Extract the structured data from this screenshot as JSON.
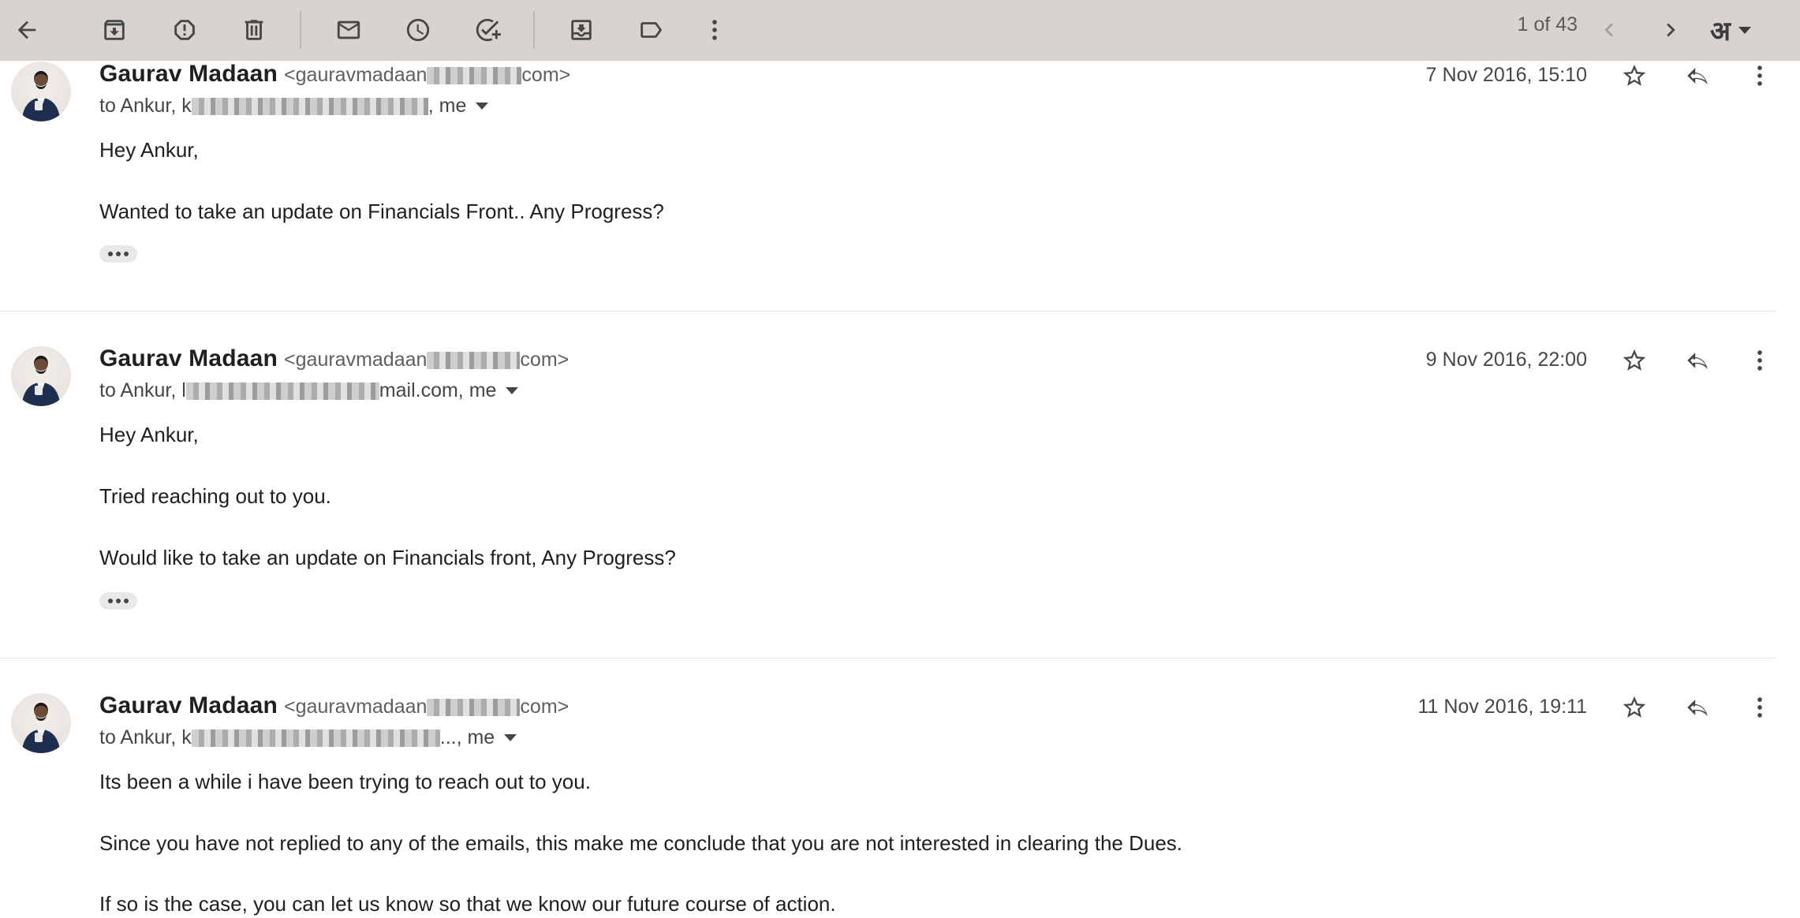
{
  "toolbar": {
    "page_count": "1 of 43",
    "language_glyph": "अ"
  },
  "messages": [
    {
      "sender_name": "Gaurav Madaan",
      "email_prefix": "<gauravmadaan",
      "email_suffix": "com>",
      "to_prefix": "to Ankur, k",
      "to_suffix": ", me",
      "date": "7 Nov 2016, 15:10",
      "lines": [
        "Hey Ankur,",
        "Wanted to take an update on Financials Front.. Any Progress?"
      ]
    },
    {
      "sender_name": "Gaurav Madaan",
      "email_prefix": "<gauravmadaan",
      "email_suffix": "com>",
      "to_prefix": "to Ankur, l",
      "to_suffix": "mail.com, me",
      "date": "9 Nov 2016, 22:00",
      "lines": [
        "Hey Ankur,",
        "Tried reaching out to you.",
        "Would like to take an update on Financials front, Any Progress?"
      ]
    },
    {
      "sender_name": "Gaurav Madaan",
      "email_prefix": "<gauravmadaan",
      "email_suffix": "com>",
      "to_prefix": "to Ankur, k",
      "to_suffix": "..., me",
      "date": "11 Nov 2016, 19:11",
      "lines": [
        "Its been a while i have been trying to reach out to you.",
        "Since you have not replied to any of the emails, this make me conclude that you are not interested in clearing the Dues.",
        "If so is the case, you can let us know so that we know our future course of action."
      ]
    }
  ],
  "colors": {
    "toolbar_bg": "#d9d3d0",
    "text_primary": "#1f1f1f",
    "text_secondary": "#444746"
  }
}
